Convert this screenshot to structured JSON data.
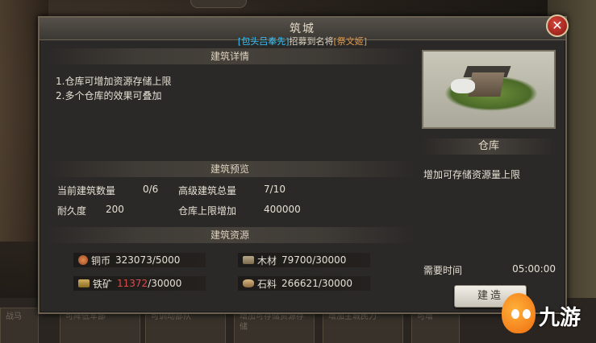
{
  "background": {
    "top_pill_text": "",
    "bottom_cards": [
      {
        "text": "战马"
      },
      {
        "text": "可降低军部"
      },
      {
        "text": "可使用阴阳道"
      },
      {
        "text": "可训动部队"
      },
      {
        "text": "增加可存储资源存储"
      },
      {
        "text": "增加主城民力"
      },
      {
        "text": "可增"
      }
    ]
  },
  "dialog": {
    "title": "筑城",
    "notice": {
      "name_a": "[包头吕奉先]",
      "middle": "招募到名将",
      "name_b": "[祭文姬]"
    },
    "close_label": "✕"
  },
  "details": {
    "header": "建筑详情",
    "lines": [
      "1.仓库可增加资源存储上限",
      "2.多个仓库的效果可叠加"
    ]
  },
  "preview": {
    "header": "建筑预览",
    "current_count_label": "当前建筑数量",
    "current_count_value": "0/6",
    "advanced_total_label": "高级建筑总量",
    "advanced_total_value": "7/10",
    "durability_label": "耐久度",
    "durability_value": "200",
    "storage_bonus_label": "仓库上限增加",
    "storage_bonus_value": "400000"
  },
  "resources": {
    "header": "建筑资源",
    "copper": {
      "label": "铜币",
      "have": "323073",
      "need": "/5000"
    },
    "wood": {
      "label": "木材",
      "have": "79700",
      "need": "/30000"
    },
    "iron": {
      "label": "铁矿",
      "have": "11372",
      "need": "/30000"
    },
    "stone": {
      "label": "石料",
      "have": "266621",
      "need": "/30000"
    }
  },
  "building": {
    "name": "仓库",
    "description": "增加可存储资源量上限",
    "time_label": "需要时间",
    "time_value": "05:00:00",
    "build_button": "建造"
  },
  "watermark": {
    "text": "九游"
  },
  "colors": {
    "highlight_blue": "#35c7ff",
    "highlight_orange": "#e39a4a",
    "insufficient_red": "#e24a4a"
  }
}
